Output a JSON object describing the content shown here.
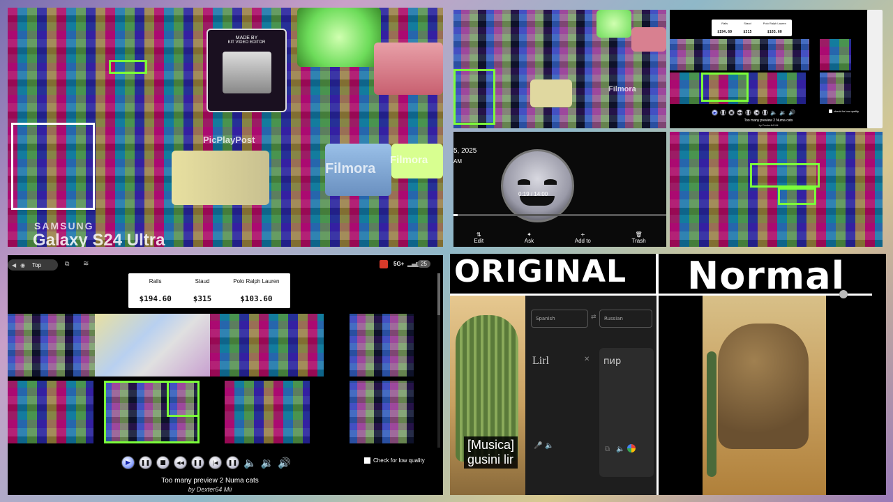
{
  "colors": {
    "accent_green": "#7cff3a",
    "panel_bg": "#000000",
    "stock_card": "#ffffff"
  },
  "top_left": {
    "samsung": "SAMSUNG",
    "model": "Galaxy S24 Ultra",
    "watermark_picplay": "PicPlayPost",
    "watermark_filmora": "Filmora",
    "credit_lines": [
      "MADE BY",
      "KIT VIDEO EDITOR"
    ]
  },
  "top_mid": {
    "watermark": "Filmora"
  },
  "top_right_phone": {
    "stocks": [
      {
        "name": "Ralls",
        "price": "$194.60"
      },
      {
        "name": "Staud",
        "price": "$315"
      },
      {
        "name": "Polo Ralph Lauren",
        "price": "$103.60"
      }
    ],
    "caption": "Too many preview 2 Numa cats",
    "byline": "by Dexter64 Mii",
    "checkbox_label": "check for low quality"
  },
  "middle_player": {
    "date": "5, 2025",
    "ampm": "AM",
    "time": "0:19 / 14:00",
    "actions": [
      "Edit",
      "Ask",
      "Add to",
      "Trash"
    ]
  },
  "bottom_left": {
    "status": {
      "left_pill": "Top",
      "network": "5G+",
      "battery": "25"
    },
    "stocks": [
      {
        "name": "Ralls",
        "price": "$194.60"
      },
      {
        "name": "Staud",
        "price": "$315"
      },
      {
        "name": "Polo Ralph Lauren",
        "price": "$103.60"
      }
    ],
    "caption": "Too many preview 2 Numa cats",
    "byline": "by Dexter64 Mii",
    "checkbox_label": "Check for low quality"
  },
  "bottom_right": {
    "left_title": "ORIGINAL",
    "right_title": "Normal",
    "subtitle_lines": [
      "[Musica]",
      "gusini lir"
    ],
    "translate": {
      "from": "Spanish",
      "to": "Russian",
      "input": "Lirl",
      "output": "пир"
    }
  }
}
